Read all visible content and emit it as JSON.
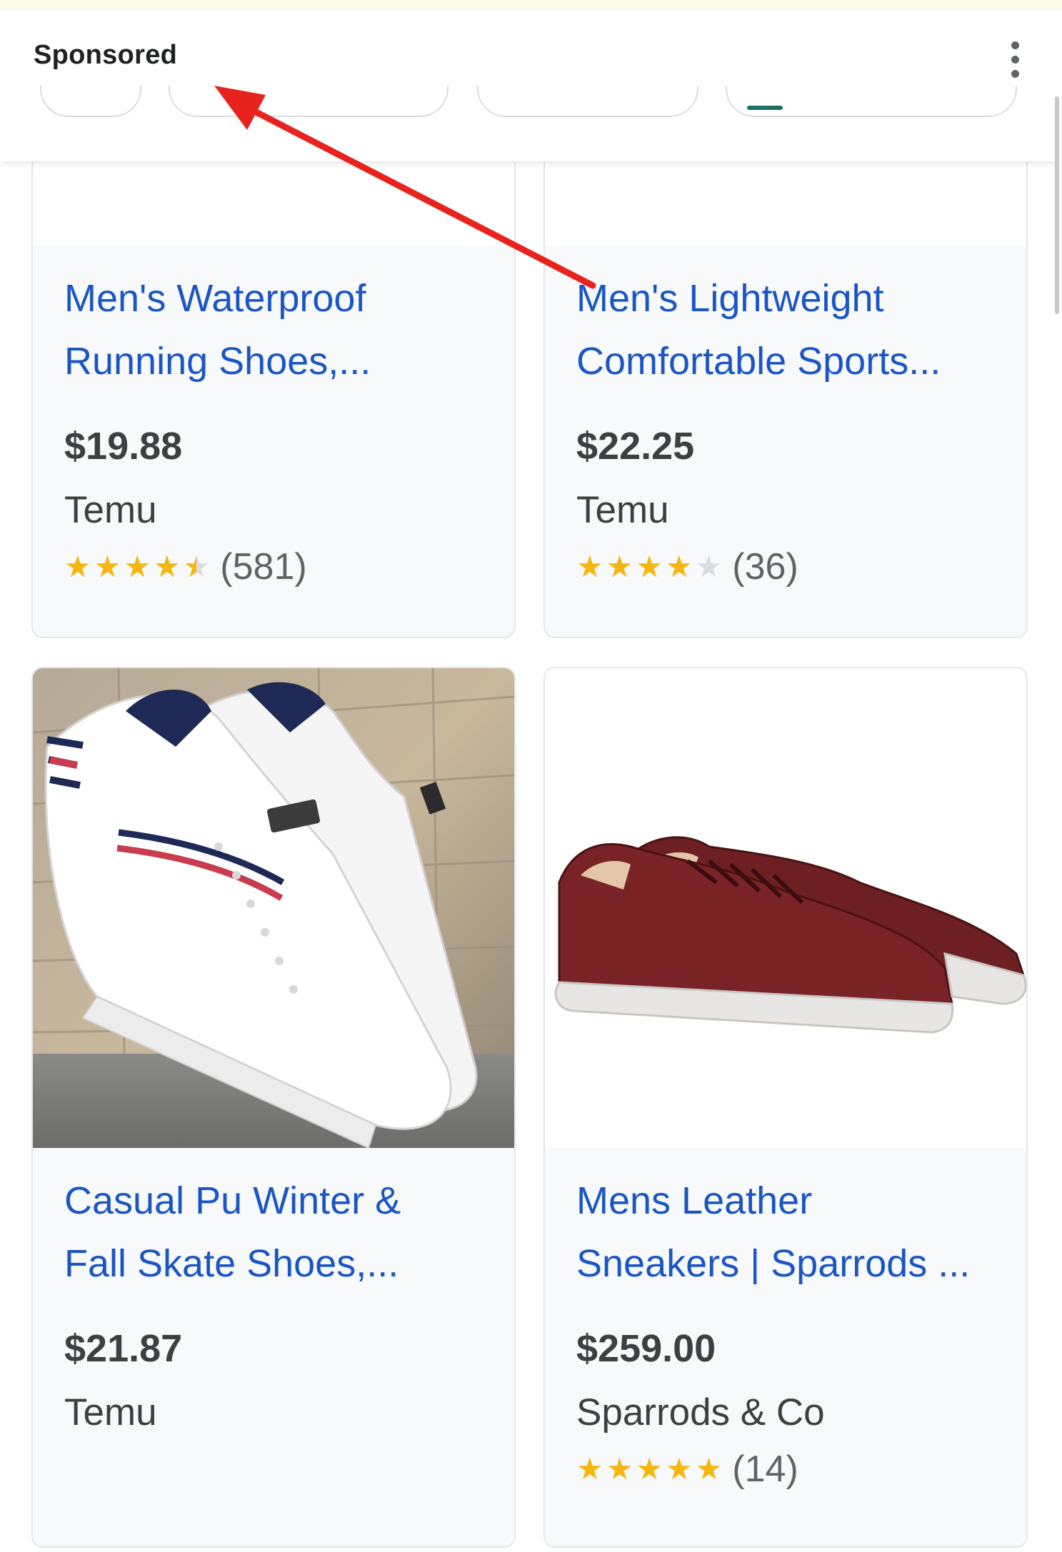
{
  "header": {
    "sponsored_label": "Sponsored",
    "more_icon": "more-vert-icon"
  },
  "products": [
    {
      "title": "Men's Waterproof\nRunning Shoes,...",
      "price": "$19.88",
      "seller": "Temu",
      "rating": 4.5,
      "reviews": "(581)"
    },
    {
      "title": "Men's Lightweight\nComfortable Sports...",
      "price": "$22.25",
      "seller": "Temu",
      "rating": 4,
      "reviews": "(36)"
    },
    {
      "title": "Casual Pu Winter &\nFall Skate Shoes,...",
      "price": "$21.87",
      "seller": "Temu",
      "image": "white-sneakers-image"
    },
    {
      "title": "Mens Leather\nSneakers | Sparrods ...",
      "price": "$259.00",
      "seller": "Sparrods & Co",
      "rating": 5,
      "reviews": "(14)",
      "image": "burgundy-leather-sneakers-image"
    }
  ],
  "colors": {
    "link": "#1a56c4",
    "star": "#f5b60f",
    "annotation": "#e8231d"
  }
}
